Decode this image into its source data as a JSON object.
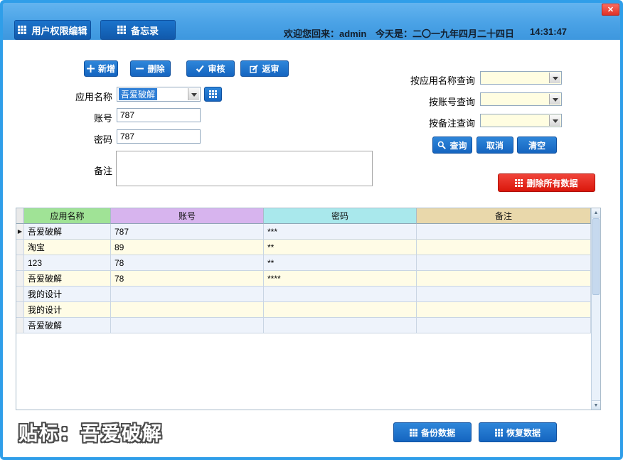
{
  "colors": {
    "frame_blue": "#2f9ee9",
    "tab_blue": "#1467c2",
    "button_blue": "#1565c0",
    "danger_red": "#da170b",
    "header_green": "#a0e396",
    "header_purple": "#d7b4ee",
    "header_cyan": "#a9e8ec",
    "header_tan": "#e9d8ab",
    "row_alt_blue": "#eef3fb",
    "row_alt_yellow": "#fffce6"
  },
  "titlebar": {
    "tabs": [
      {
        "label": "用户权限编辑"
      },
      {
        "label": "备忘录"
      }
    ],
    "welcome": "欢迎您回来：admin",
    "date": "今天是：二〇一九年四月二十四日",
    "time": "14:31:47",
    "close": "✕"
  },
  "toolbar": {
    "add": "新增",
    "remove": "删除",
    "audit": "审核",
    "return_audit": "返审"
  },
  "form": {
    "app_name_label": "应用名称",
    "app_name_value": "吾爱破解",
    "account_label": "账号",
    "account_value": "787",
    "password_label": "密码",
    "password_value": "787",
    "remarks_label": "备注",
    "remarks_value": ""
  },
  "query": {
    "by_app_label": "按应用名称查询",
    "by_account_label": "按账号查询",
    "by_remarks_label": "按备注查询",
    "by_app_value": "",
    "by_account_value": "",
    "by_remarks_value": "",
    "search": "查询",
    "cancel": "取消",
    "clear": "清空",
    "delete_all": "删除所有数据"
  },
  "table": {
    "headers": [
      "应用名称",
      "账号",
      "密码",
      "备注"
    ],
    "row_marker": "▶",
    "selected_row_index": 0,
    "rows": [
      {
        "app": "吾爱破解",
        "account": "787",
        "password": "***",
        "remarks": ""
      },
      {
        "app": "淘宝",
        "account": "89",
        "password": "**",
        "remarks": ""
      },
      {
        "app": "123",
        "account": "78",
        "password": "**",
        "remarks": ""
      },
      {
        "app": "吾爱破解",
        "account": "78",
        "password": "****",
        "remarks": ""
      },
      {
        "app": "我的设计",
        "account": "",
        "password": "",
        "remarks": ""
      },
      {
        "app": "我的设计",
        "account": "",
        "password": "",
        "remarks": ""
      },
      {
        "app": "吾爱破解",
        "account": "",
        "password": "",
        "remarks": ""
      }
    ]
  },
  "footer": {
    "watermark": "贴标：吾爱破解",
    "backup": "备份数据",
    "restore": "恢复数据"
  }
}
